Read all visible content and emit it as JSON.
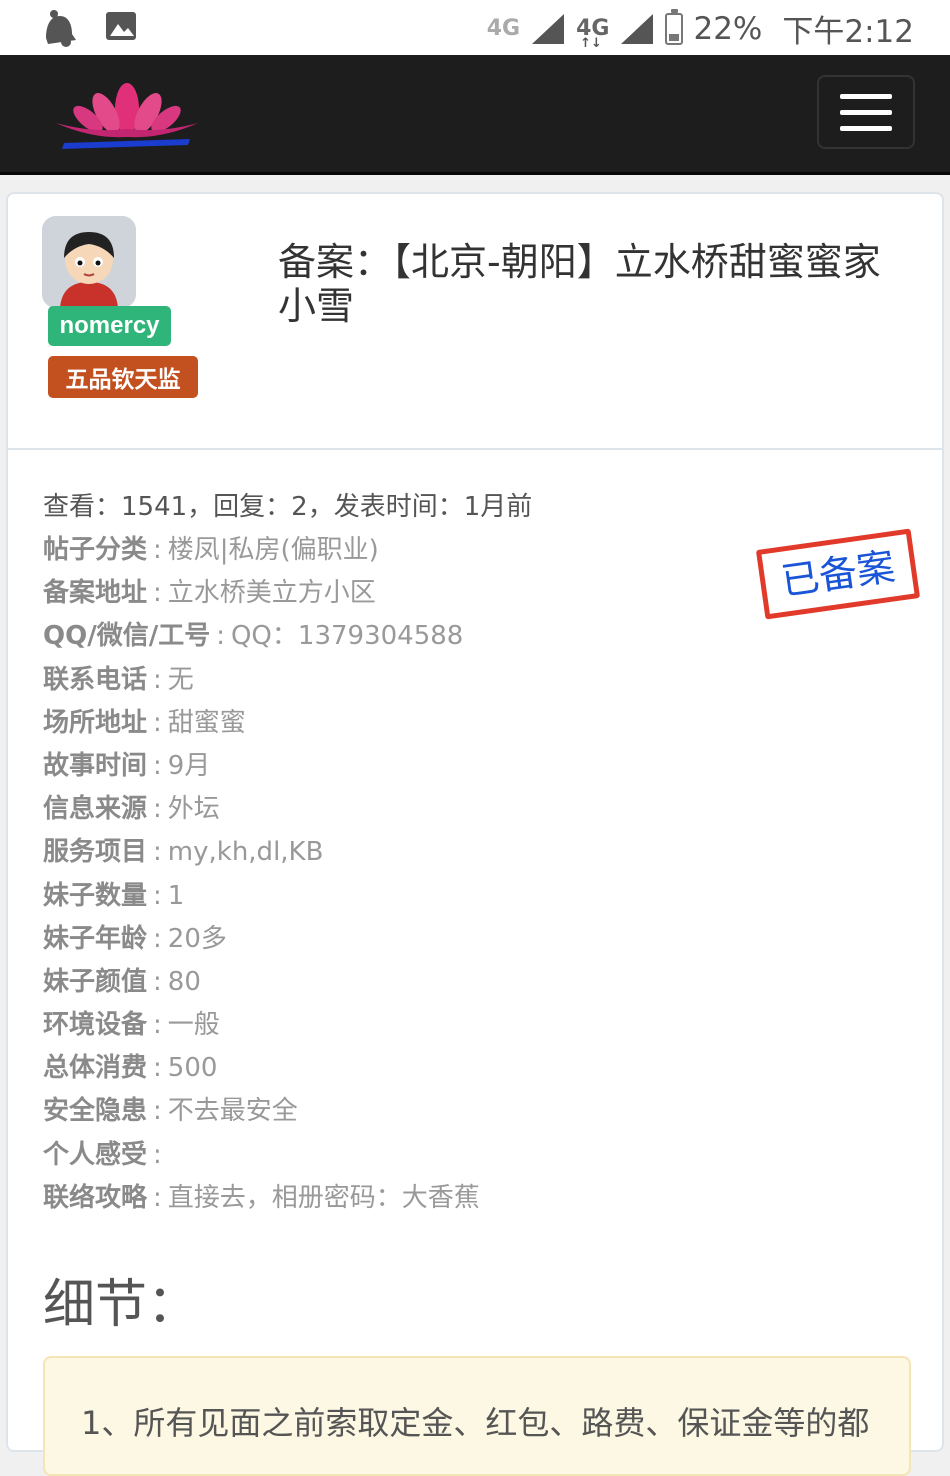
{
  "status_bar": {
    "net1": "4G",
    "net2": "4G",
    "battery": "22%",
    "time": "下午2:12",
    "icons": [
      "bell-icon",
      "image-icon",
      "signal-icon",
      "battery-icon"
    ]
  },
  "navbar": {
    "logo": "lotus-logo",
    "menu": "hamburger-menu-icon",
    "colors": {
      "background": "#1d1d1d",
      "logo_pink": "#e0307a",
      "logo_blue": "#1a3ccf"
    }
  },
  "post": {
    "author": {
      "username": "nomercy",
      "rank": "五品钦天监",
      "colors": {
        "username_badge": "#2fb47a",
        "rank_badge": "#c3501f"
      }
    },
    "title": "备案：【北京-朝阳】立水桥甜蜜蜜家小雪",
    "meta": "查看：1541，回复：2，发表时间：1月前",
    "stamp": "已备案",
    "fields": [
      {
        "label": "帖子分类",
        "value": "楼凤|私房(偏职业)"
      },
      {
        "label": "备案地址",
        "value": "立水桥美立方小区"
      },
      {
        "label": "QQ/微信/工号",
        "value": "QQ：1379304588"
      },
      {
        "label": "联系电话",
        "value": "无"
      },
      {
        "label": "场所地址",
        "value": "甜蜜蜜"
      },
      {
        "label": "故事时间",
        "value": "9月"
      },
      {
        "label": "信息来源",
        "value": "外坛"
      },
      {
        "label": "服务项目",
        "value": "my,kh,dl,KB"
      },
      {
        "label": "妹子数量",
        "value": "1"
      },
      {
        "label": "妹子年龄",
        "value": "20多"
      },
      {
        "label": "妹子颜值",
        "value": "80"
      },
      {
        "label": "环境设备",
        "value": "一般"
      },
      {
        "label": "总体消费",
        "value": "500"
      },
      {
        "label": "安全隐患",
        "value": "不去最安全"
      },
      {
        "label": "个人感受",
        "value": ""
      },
      {
        "label": "联络攻略",
        "value": "直接去，相册密码：大香蕉"
      }
    ],
    "details_title": "细节：",
    "notice": "1、所有见面之前索取定金、红包、路费、保证金等的都"
  }
}
